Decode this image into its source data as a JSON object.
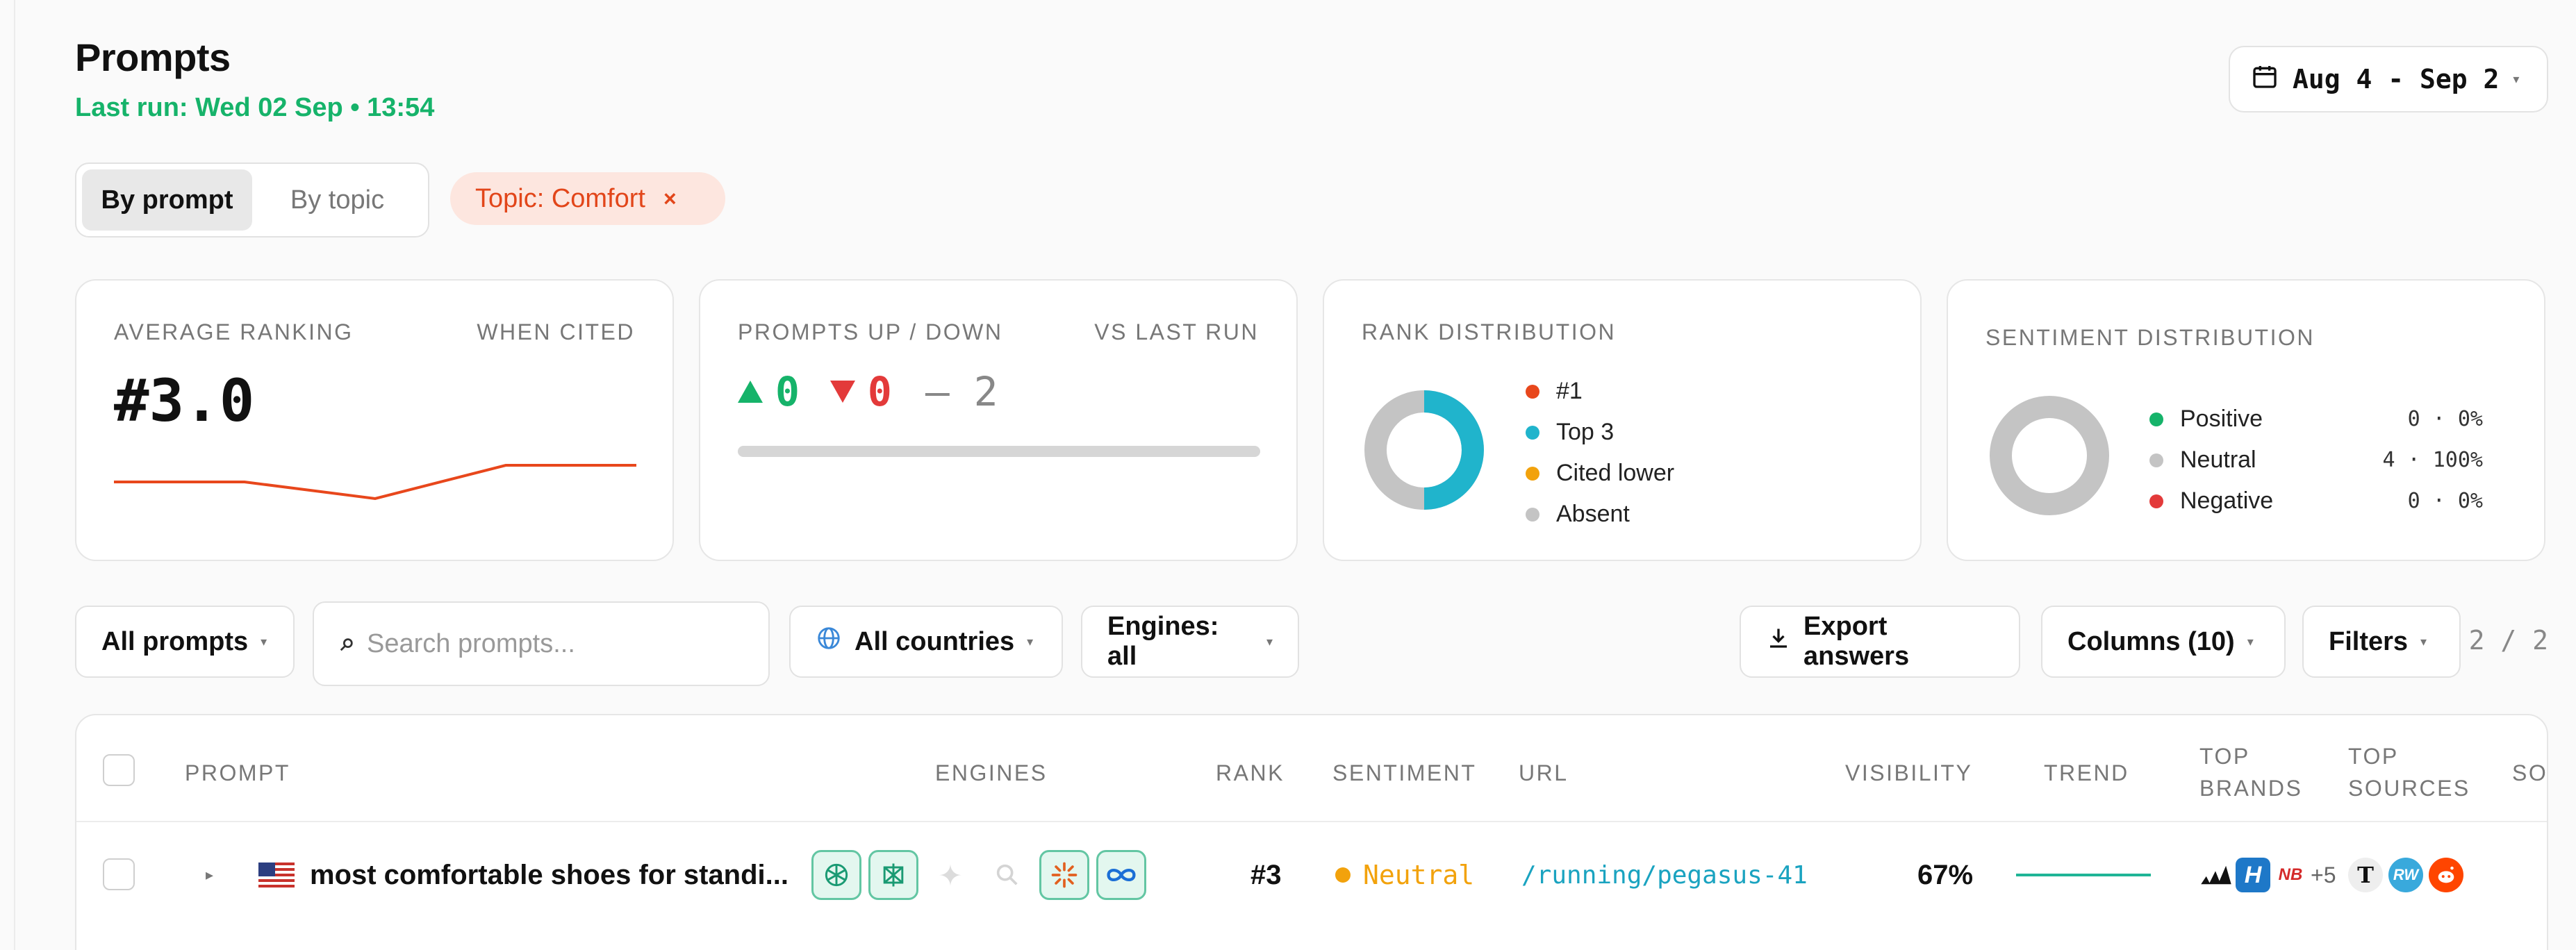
{
  "header": {
    "title": "Prompts",
    "last_run": "Last run: Wed 02 Sep • 13:54",
    "date_range": "Aug 4 - Sep 2"
  },
  "view_toggle": {
    "options": [
      "By prompt",
      "By topic"
    ],
    "active": "By prompt"
  },
  "filter_chip": {
    "label": "Topic: Comfort"
  },
  "cards": {
    "avg_ranking": {
      "label": "AVERAGE RANKING",
      "right_label": "WHEN CITED",
      "value": "#3.0",
      "trend": [
        3.0,
        3.0,
        3.6,
        2.4,
        2.4
      ]
    },
    "prompts_updown": {
      "label": "PROMPTS UP / DOWN",
      "right_label": "VS LAST RUN",
      "up": "0",
      "down": "0",
      "same": "– 2"
    },
    "rank_distribution": {
      "label": "RANK DISTRIBUTION",
      "items": [
        {
          "label": "#1",
          "value": "0",
          "color": "#e8471c"
        },
        {
          "label": "Top 3",
          "value": "1",
          "color": "#20b4cc"
        },
        {
          "label": "Cited lower",
          "value": "0",
          "color": "#f2a20c"
        },
        {
          "label": "Absent",
          "value": "1",
          "color": "#c4c4c4"
        }
      ]
    },
    "sentiment_distribution": {
      "label": "SENTIMENT DISTRIBUTION",
      "items": [
        {
          "label": "Positive",
          "value": "0 · 0%",
          "color": "#16b36a"
        },
        {
          "label": "Neutral",
          "value": "4 · 100%",
          "color": "#c4c4c4"
        },
        {
          "label": "Negative",
          "value": "0 · 0%",
          "color": "#e33a3a"
        }
      ]
    }
  },
  "controls": {
    "all_prompts": "All prompts",
    "search_placeholder": "Search prompts...",
    "countries": "All countries",
    "engines": "Engines: all",
    "export": "Export answers",
    "columns": "Columns (10)",
    "filters": "Filters",
    "pager": "2 / 2"
  },
  "table": {
    "headers": {
      "prompt": "PROMPT",
      "engines": "ENGINES",
      "rank": "RANK",
      "sentiment": "SENTIMENT",
      "url": "URL",
      "visibility": "VISIBILITY",
      "trend": "TREND",
      "top_brands": [
        "TOP",
        "BRANDS"
      ],
      "top_sources": [
        "TOP",
        "SOURCES"
      ],
      "so": "SO"
    },
    "rows": [
      {
        "prompt": "most comfortable shoes for standi...",
        "rank": "#3",
        "sentiment": "Neutral",
        "sentiment_color": "#f2a20c",
        "url": "/running/pegasus-41",
        "visibility": "67%",
        "brands_more": "+5"
      }
    ]
  }
}
